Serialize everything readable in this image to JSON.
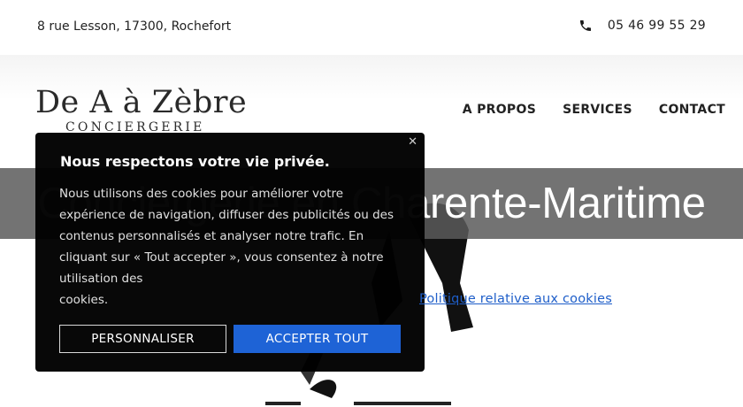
{
  "topbar": {
    "address": "8 rue Lesson, 17300, Rochefort",
    "phone": "05 46 99 55 29",
    "phone_icon": "phone-icon"
  },
  "logo": {
    "main": "De A à Zèbre",
    "sub": "CONCIERGERIE"
  },
  "nav": {
    "items": [
      {
        "label": "A PROPOS"
      },
      {
        "label": "SERVICES"
      },
      {
        "label": "CONTACT"
      }
    ]
  },
  "banner": {
    "title": "Conciergerie en Charente-Maritime"
  },
  "cookie_banner": {
    "close_label": "✕",
    "title": "Nous respectons votre vie privée.",
    "text_line1": "Nous utilisons des cookies pour améliorer votre",
    "text_line2": "expérience de navigation, diffuser des publicités ou des",
    "text_line3": "contenus personnalisés et analyser notre trafic. En",
    "text_line4": "cliquant sur « Tout accepter », vous consentez à notre",
    "text_line5": "utilisation des",
    "text_line6": "cookies.",
    "customize_label": "PERSONNALISER",
    "accept_label": "ACCEPTER TOUT",
    "policy_link": "Politique relative aux cookies",
    "accept_color": "#1e63d6"
  }
}
